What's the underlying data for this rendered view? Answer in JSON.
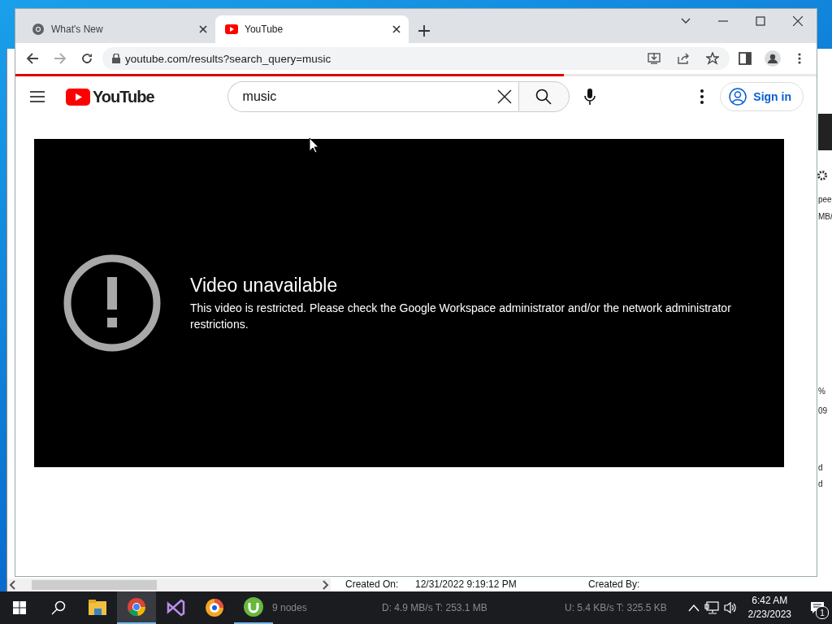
{
  "browser": {
    "tabs": [
      {
        "title": "What's New",
        "selected": false
      },
      {
        "title": "YouTube",
        "selected": true
      }
    ],
    "address": "youtube.com/results?search_query=music",
    "loading": {
      "level": 0.685
    }
  },
  "youtube": {
    "logo": "YouTube",
    "search": {
      "value": "music"
    },
    "sign_in": "Sign in"
  },
  "player": {
    "heading": "Video unavailable",
    "message": "This video is restricted. Please check the Google Workspace administrator and/or the network administrator restrictions."
  },
  "background_window": {
    "fragments": [
      "pee",
      "MB/",
      "%",
      "09",
      "d",
      "d"
    ],
    "details": [
      "Created On:",
      "12/31/2022 9:19:12 PM",
      "Created By:"
    ]
  },
  "taskbar": {
    "apps": [
      {
        "kind": "explorer",
        "selected": false,
        "running": false
      },
      {
        "kind": "chrome",
        "selected": true,
        "running": true
      },
      {
        "kind": "studio",
        "selected": false,
        "running": false
      },
      {
        "kind": "browser",
        "selected": false,
        "running": false
      },
      {
        "kind": "torrent",
        "selected": false,
        "running": true
      }
    ],
    "status": [
      "9 nodes",
      "D: 4.9 MB/s T: 253.1 MB",
      "U: 5.4 KB/s T: 325.5 KB"
    ],
    "time": "6:42 AM",
    "date": "2/23/2023",
    "notifications": "1"
  }
}
